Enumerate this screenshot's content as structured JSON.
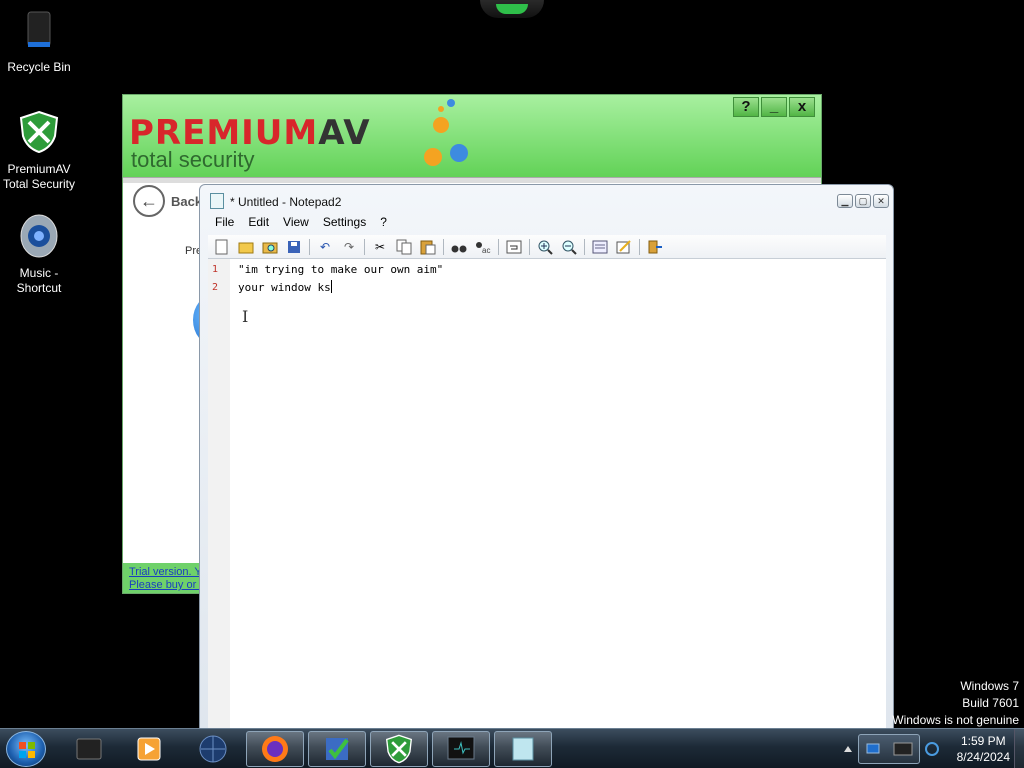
{
  "desktop": {
    "icons": [
      {
        "label": "Recycle Bin"
      },
      {
        "label": "PremiumAV\nTotal Security"
      },
      {
        "label": "Music -\nShortcut"
      }
    ]
  },
  "premiumav": {
    "logo_main": "PREMIUM",
    "logo_av": "AV",
    "subtitle": "total security",
    "help_label": "?",
    "minimize_label": "_",
    "close_label": "x",
    "back_label": "Back",
    "pre_text": "Pre",
    "footer_line1": "Trial version. Y",
    "footer_line2": "Please buy or a"
  },
  "notepad": {
    "title": "* Untitled - Notepad2",
    "menu": [
      "File",
      "Edit",
      "View",
      "Settings",
      "?"
    ],
    "lines": [
      {
        "num": "1",
        "text": "\"im trying to make our own aim\""
      },
      {
        "num": "2",
        "text": "your window ks"
      }
    ]
  },
  "genuine_notice": {
    "line1": "Windows 7",
    "line2": "Build 7601",
    "line3": "Windows is not genuine"
  },
  "taskbar": {
    "time": "1:59 PM",
    "date": "8/24/2024"
  },
  "colors": {
    "pav_green": "#62d257",
    "pav_red": "#d8262b",
    "line_number": "#c0342a"
  }
}
